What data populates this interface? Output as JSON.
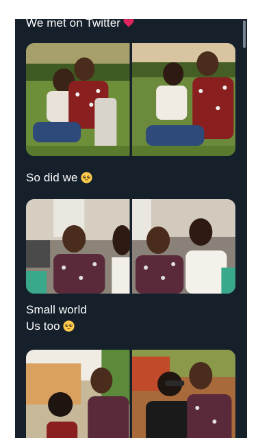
{
  "posts": [
    {
      "text": "We met on Twitter",
      "emoji": "heart-emoji"
    },
    {
      "text": "So did we",
      "emoji": "pleading-face-emoji"
    },
    {
      "line1": "Small world",
      "line2": "Us too",
      "emoji": "pleading-face-emoji"
    }
  ],
  "photos": [
    {
      "scene": "couple-seated-outdoors-garden"
    },
    {
      "scene": "couple-embrace-outdoors-garden"
    },
    {
      "scene": "couple-smiling-indoors-cafe"
    },
    {
      "scene": "couple-cheek-to-cheek-indoors-cafe"
    },
    {
      "scene": "couple-hugging-outdoors-building"
    },
    {
      "scene": "couple-smiling-outdoors-building"
    }
  ],
  "colors": {
    "background": "#15202b",
    "text": "#ffffff",
    "heart": "#e0245e",
    "emoji": "#ffcc4d"
  }
}
